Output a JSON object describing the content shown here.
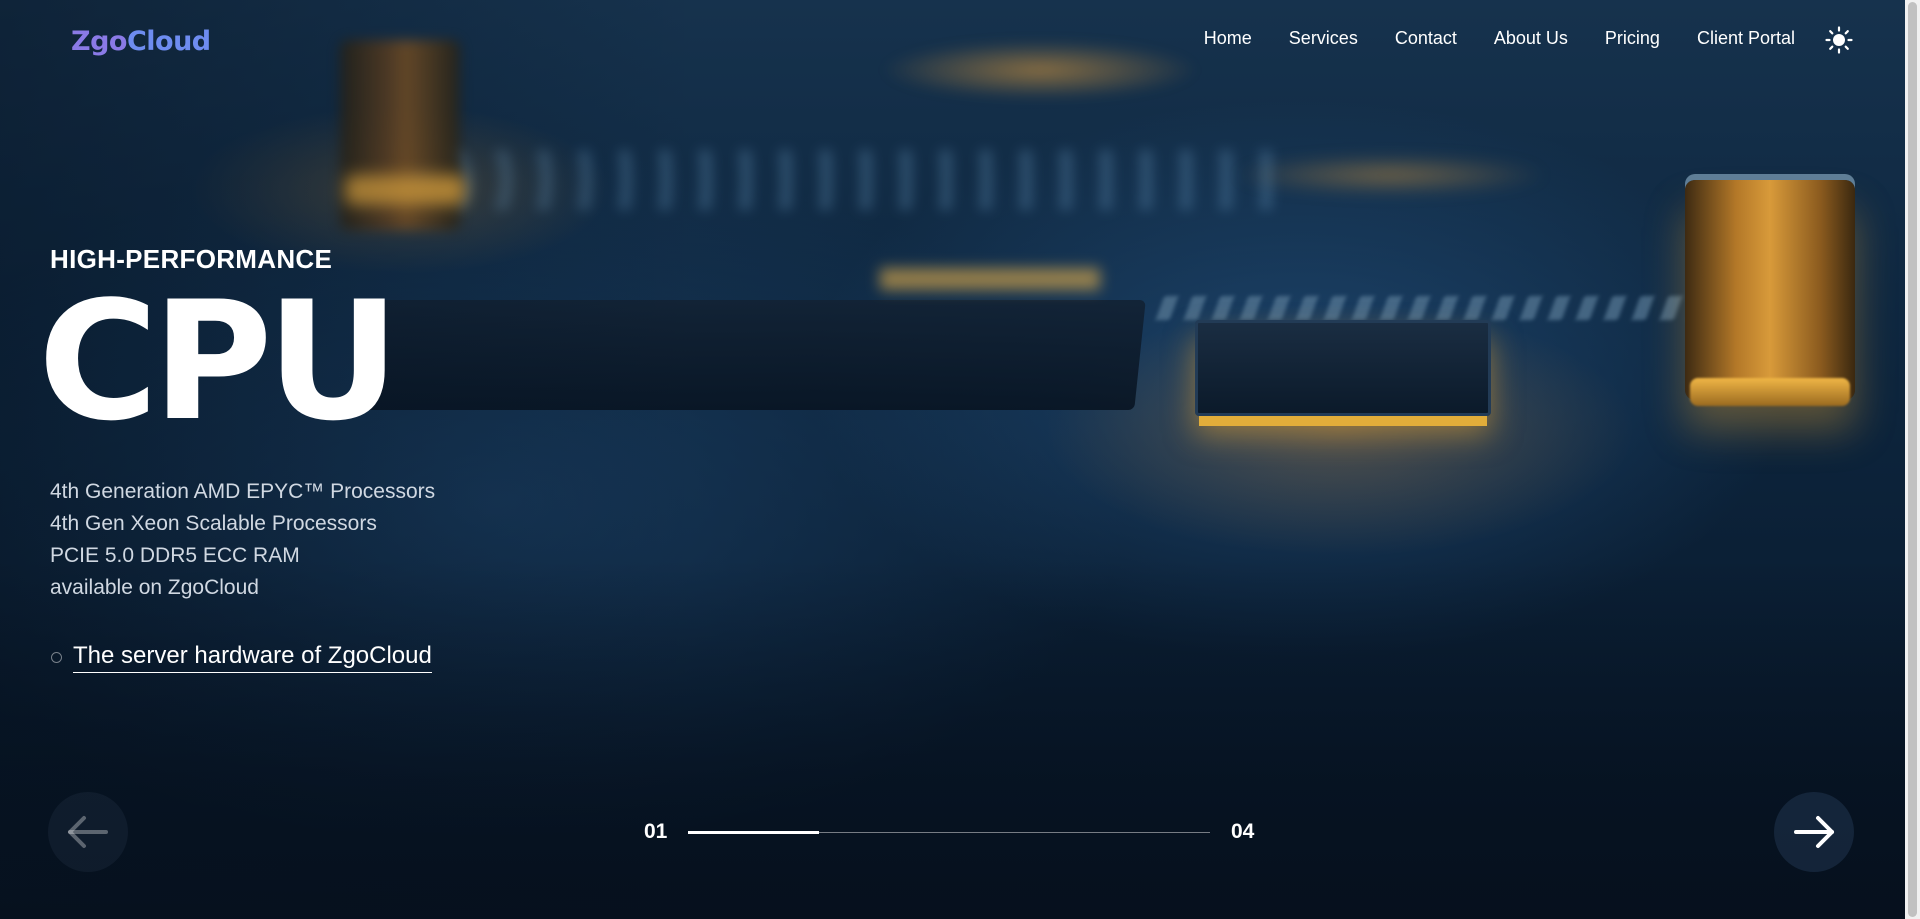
{
  "brand": {
    "logo_part1": "Zgo",
    "logo_part2": "Cloud",
    "logo_color1": "#8a7ae6",
    "logo_color2": "#6e8cf0"
  },
  "nav": {
    "items": [
      {
        "label": "Home"
      },
      {
        "label": "Services"
      },
      {
        "label": "Contact"
      },
      {
        "label": "About Us"
      },
      {
        "label": "Pricing"
      },
      {
        "label": "Client Portal"
      }
    ],
    "theme_toggle_icon": "sun-icon"
  },
  "hero": {
    "eyebrow": "HIGH-PERFORMANCE",
    "title": "CPU",
    "features": [
      "4th Generation AMD EPYC™ Processors",
      "4th Gen Xeon Scalable Processors",
      "PCIE 5.0 DDR5 ECC RAM",
      "available on ZgoCloud"
    ],
    "cta_label": "The server hardware of ZgoCloud"
  },
  "slider": {
    "current": "01",
    "total": "04",
    "progress_fraction": 0.25,
    "prev_icon": "arrow-left-icon",
    "next_icon": "arrow-right-icon"
  },
  "colors": {
    "text": "#ffffff",
    "feature_text": "#d0d8e2",
    "background": "#0e2740",
    "accent_glow": "#e2ad3a"
  }
}
